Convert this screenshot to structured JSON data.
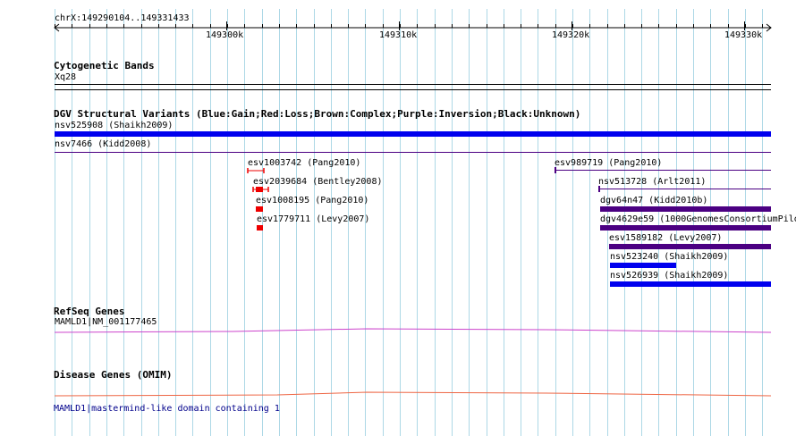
{
  "ruler": {
    "region": "chrX:149290104..149331433",
    "ticks": [
      "149300k",
      "149310k",
      "149320k",
      "149330k"
    ]
  },
  "tracks": {
    "cytoband": {
      "title": "Cytogenetic Bands",
      "band": "Xq28"
    },
    "dgv": {
      "title": "DGV Structural Variants (Blue:Gain;Red:Loss;Brown:Complex;Purple:Inversion;Black:Unknown)"
    },
    "refseq": {
      "title": "RefSeq Genes",
      "gene": "MAMLD1|NM_001177465"
    },
    "omim": {
      "title": "Disease Genes (OMIM)",
      "gene": "MAMLD1|mastermind-like domain containing 1"
    }
  },
  "variants": [
    {
      "id": "nsv525908",
      "label": "nsv525908 (Shaikh2009)",
      "color": "#0000ee",
      "style": "thick"
    },
    {
      "id": "nsv7466",
      "label": "nsv7466 (Kidd2008)",
      "color": "#4b0082",
      "style": "thin"
    },
    {
      "id": "esv1003742",
      "label": "esv1003742 (Pang2010)",
      "color": "#ee0000",
      "style": "bracket"
    },
    {
      "id": "esv2039684",
      "label": "esv2039684 (Bentley2008)",
      "color": "#ee0000",
      "style": "bracket-block"
    },
    {
      "id": "esv1008195",
      "label": "esv1008195 (Pang2010)",
      "color": "#ee0000",
      "style": "block"
    },
    {
      "id": "esv1779711",
      "label": "esv1779711 (Levy2007)",
      "color": "#ee0000",
      "style": "block"
    },
    {
      "id": "esv989719",
      "label": "esv989719 (Pang2010)",
      "color": "#4b0082",
      "style": "thin"
    },
    {
      "id": "nsv513728",
      "label": "nsv513728 (Arlt2011)",
      "color": "#4b0082",
      "style": "thin"
    },
    {
      "id": "dgv64n47",
      "label": "dgv64n47 (Kidd2010b)",
      "color": "#4b0082",
      "style": "thick"
    },
    {
      "id": "dgv4629e59",
      "label": "dgv4629e59 (1000GenomesConsortiumPilo",
      "color": "#4b0082",
      "style": "thick"
    },
    {
      "id": "esv1589182",
      "label": "esv1589182 (Levy2007)",
      "color": "#4b0082",
      "style": "thick"
    },
    {
      "id": "nsv523240",
      "label": "nsv523240 (Shaikh2009)",
      "color": "#0000ee",
      "style": "thick"
    },
    {
      "id": "nsv526939",
      "label": "nsv526939 (Shaikh2009)",
      "color": "#0000ee",
      "style": "thick"
    }
  ],
  "colors": {
    "gridline": "#add8e6",
    "refseq_line": "#cc44cc",
    "omim_line": "#ee6644",
    "gain": "#0000ee",
    "loss": "#ee0000",
    "inversion": "#4b0082"
  }
}
